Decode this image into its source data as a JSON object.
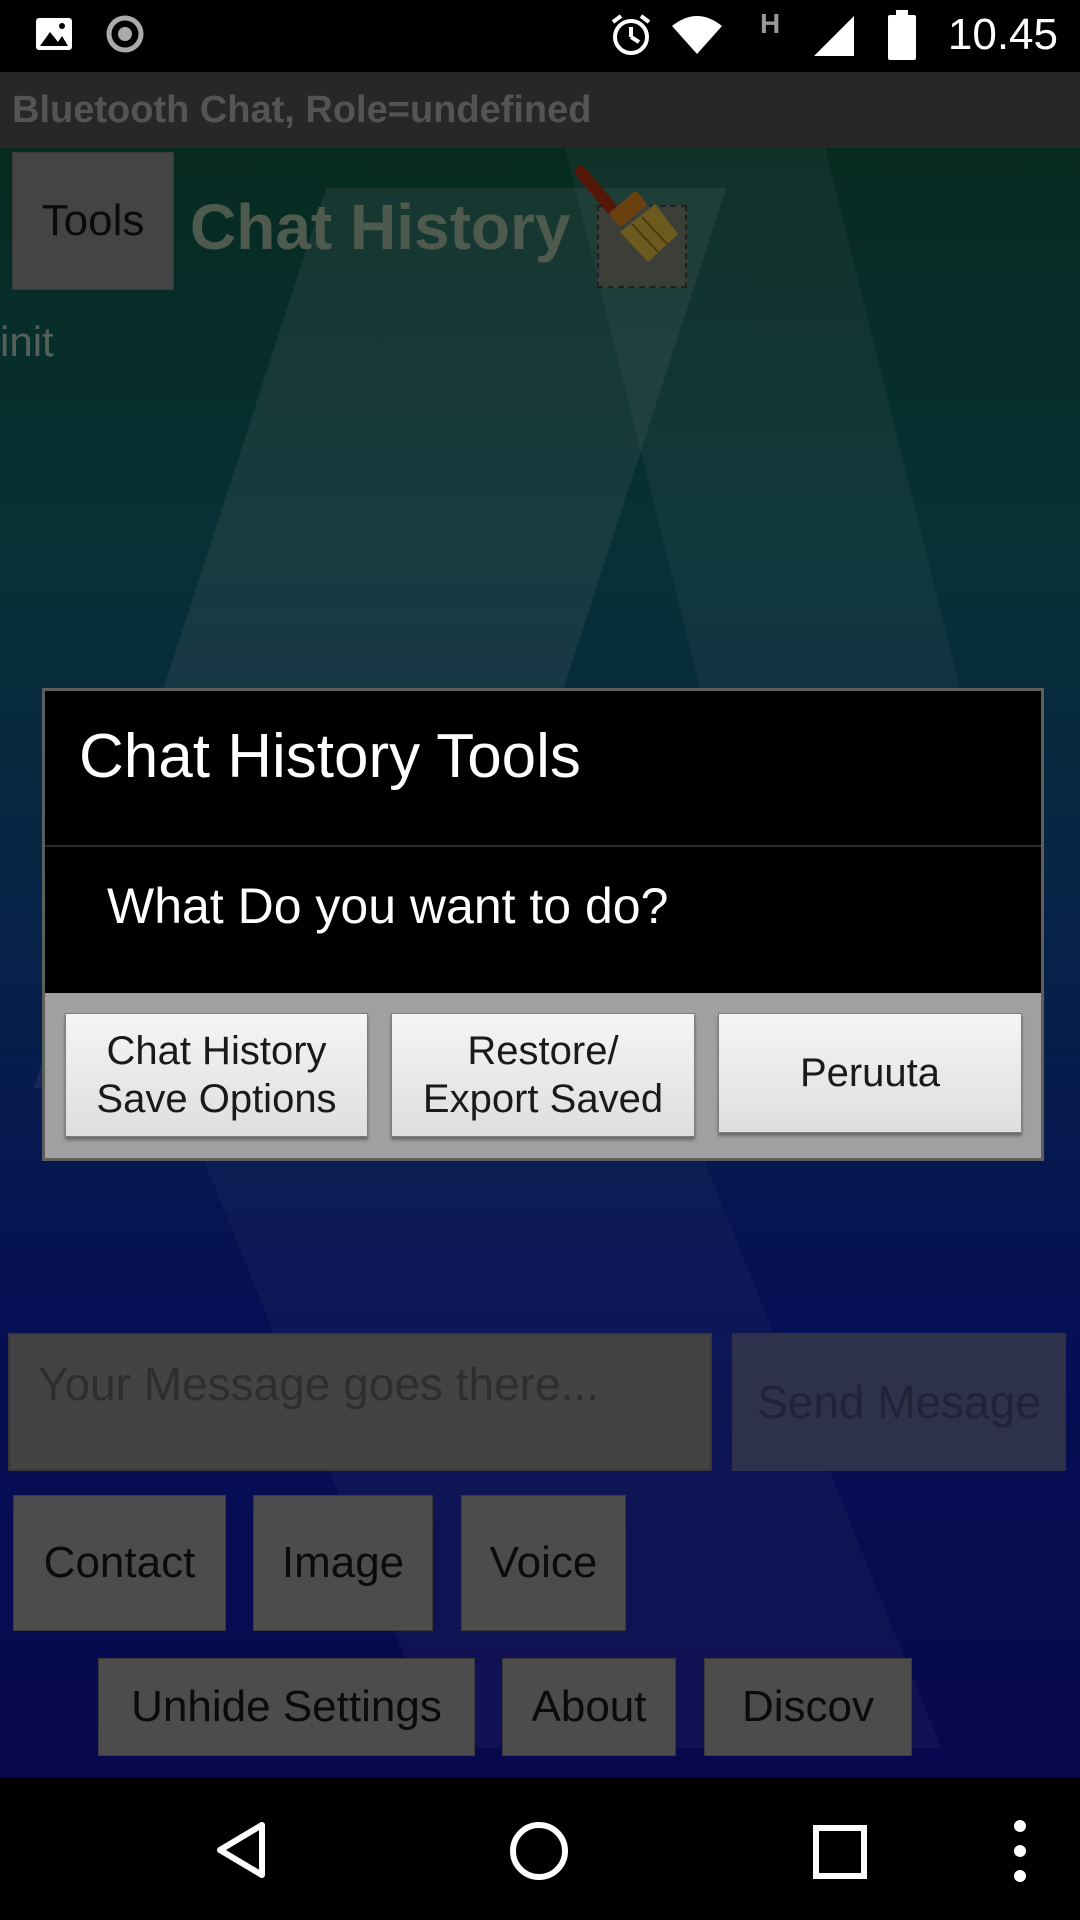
{
  "status_bar": {
    "time": "10.45",
    "network_label": "H",
    "icons": [
      "image-icon",
      "circle-notification-icon",
      "alarm-icon",
      "wifi-icon",
      "cell-signal-icon",
      "battery-icon"
    ]
  },
  "app_bar": {
    "title": "Bluetooth Chat, Role=undefined"
  },
  "main": {
    "tools_label": "Tools",
    "chat_history_title": "Chat History",
    "init_text": "init",
    "message_placeholder": "Your Message goes there...",
    "send_label": "Send Mesage",
    "row1": [
      "Contact",
      "Image",
      "Voice"
    ],
    "row2": [
      "Unhide Settings",
      "About",
      "Discov"
    ]
  },
  "dialog": {
    "title": "Chat History Tools",
    "message": "What Do you want to do?",
    "buttons": [
      {
        "line1": "Chat History",
        "line2": "Save Options"
      },
      {
        "line1": "Restore/",
        "line2": "Export Saved"
      },
      {
        "line1": "Peruuta",
        "line2": ""
      }
    ]
  },
  "nav_bar": {
    "icons": [
      "back-icon",
      "home-icon",
      "recents-icon",
      "overflow-menu-icon"
    ]
  },
  "colors": {
    "dialog_bg": "#000000",
    "dialog_button_bar": "#a0a0a0",
    "appbar_bg": "#474747"
  }
}
